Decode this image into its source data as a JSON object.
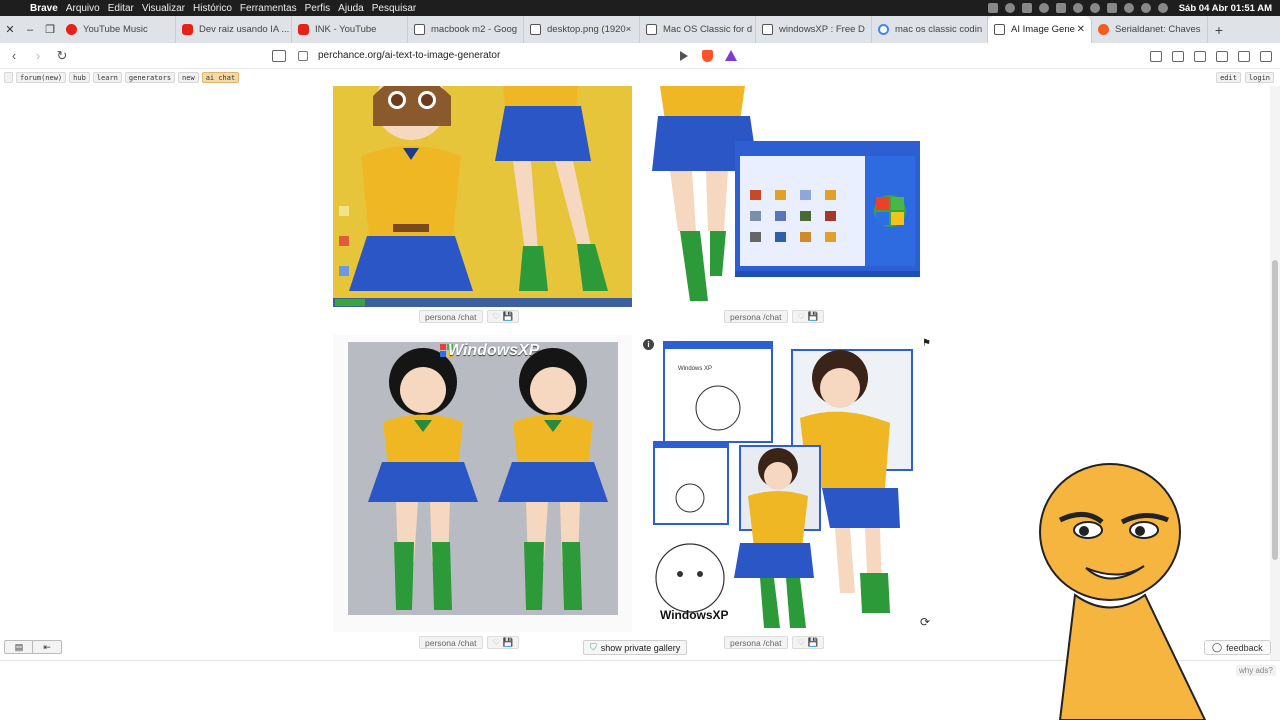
{
  "menubar": {
    "app": "Brave",
    "items": [
      "Arquivo",
      "Editar",
      "Visualizar",
      "Histórico",
      "Ferramentas",
      "Perfis",
      "Ajuda",
      "Pesquisar"
    ],
    "clock": "Sáb 04 Abr 01:51 AM"
  },
  "tabs": [
    {
      "label": "YouTube Music",
      "icon": "ytm"
    },
    {
      "label": "Dev raiz usando IA ...",
      "icon": "yt"
    },
    {
      "label": "INK - YouTube",
      "icon": "yt"
    },
    {
      "label": "macbook m2 - Goog",
      "icon": "doc"
    },
    {
      "label": "desktop.png (1920×",
      "icon": "doc"
    },
    {
      "label": "Mac OS Classic for d",
      "icon": "doc"
    },
    {
      "label": "windowsXP : Free D",
      "icon": "doc"
    },
    {
      "label": "mac os classic codin",
      "icon": "g"
    },
    {
      "label": "AI Image Gene",
      "icon": "doc",
      "active": true
    },
    {
      "label": "Serialdanet: Chaves",
      "icon": "br"
    }
  ],
  "toolbar": {
    "url": "perchance.org/ai-text-to-image-generator"
  },
  "nav": {
    "chips": [
      "forum(new)",
      "hub",
      "learn",
      "generators",
      "new",
      "ai chat"
    ],
    "right_chips": [
      "edit",
      "login"
    ]
  },
  "gallery": {
    "persona_label": "persona / ",
    "chat_label": "chat",
    "icons_label": "♡ 💾",
    "winxp_text_1": "WindowsXP",
    "winxp_text_2": "WindowsXP",
    "xp_caption": "Windows XP"
  },
  "bottom": {
    "private_gallery": "show private gallery",
    "feedback": "feedback",
    "why_ads": "why ads?"
  },
  "colors": {
    "accent_orange": "#f5b53f",
    "xp_blue": "#2d5fd2",
    "skirt_blue": "#2b56c6",
    "sweater_yellow": "#f0b725"
  }
}
